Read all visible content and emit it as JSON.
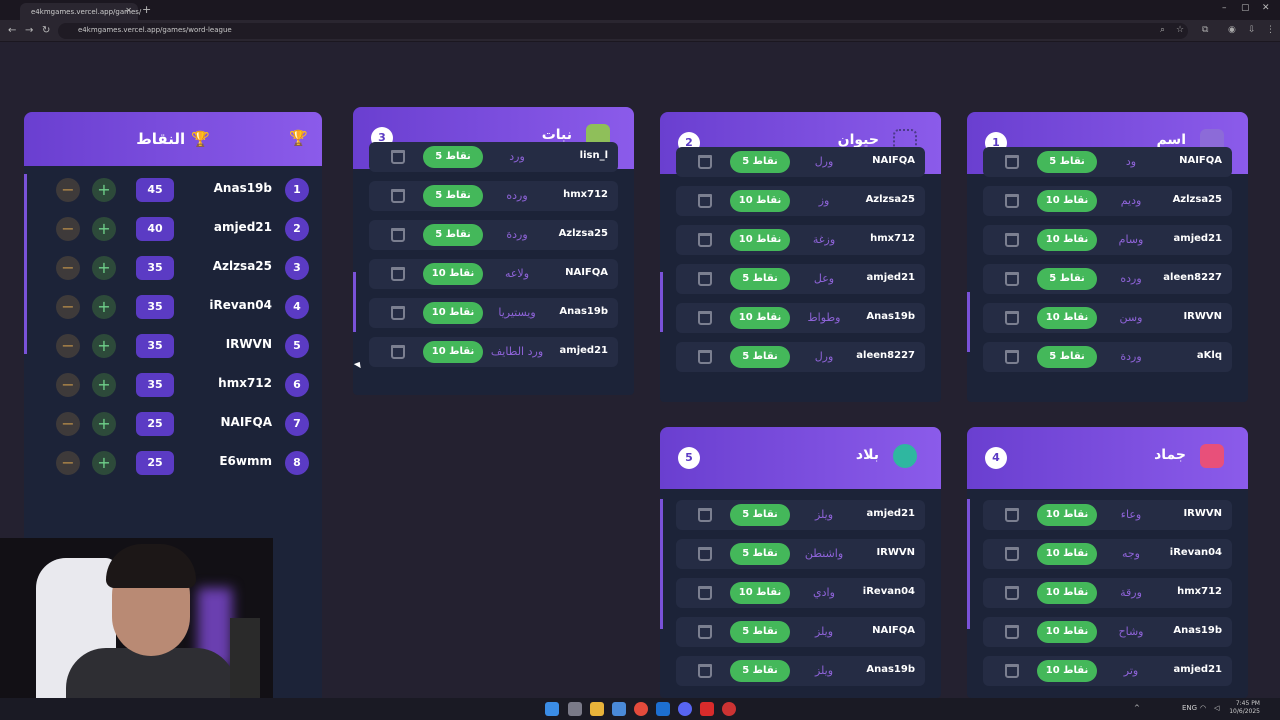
{
  "browser": {
    "tab_title": "e4kmgames.vercel.app/games/",
    "url": "e4kmgames.vercel.app/games/word-league",
    "lang": "ENG",
    "time": "7:45 PM",
    "date": "10/6/2025"
  },
  "scoreboard": {
    "title": "النقاط",
    "minus": "−",
    "plus": "+",
    "rows": [
      {
        "rank": "1",
        "name": "Anas19b",
        "points": "45"
      },
      {
        "rank": "2",
        "name": "amjed21",
        "points": "40"
      },
      {
        "rank": "3",
        "name": "Azlzsa25",
        "points": "35"
      },
      {
        "rank": "4",
        "name": "iRevan04",
        "points": "35"
      },
      {
        "rank": "5",
        "name": "IRWVN",
        "points": "35"
      },
      {
        "rank": "6",
        "name": "hmx712",
        "points": "35"
      },
      {
        "rank": "7",
        "name": "NAIFQA",
        "points": "25"
      },
      {
        "rank": "8",
        "name": "E6wmm",
        "points": "25"
      }
    ]
  },
  "categories": [
    {
      "num": "1",
      "title": "اسم",
      "icon": "user-icon",
      "rows": [
        {
          "name": "NAIFQA",
          "word": "ود",
          "points": "5 نقاط"
        },
        {
          "name": "Azlzsa25",
          "word": "وديم",
          "points": "10 نقاط"
        },
        {
          "name": "amjed21",
          "word": "وسام",
          "points": "10 نقاط"
        },
        {
          "name": "aleen8227",
          "word": "ورده",
          "points": "5 نقاط"
        },
        {
          "name": "IRWVN",
          "word": "وسن",
          "points": "10 نقاط"
        },
        {
          "name": "aKlq",
          "word": "وردة",
          "points": "5 نقاط"
        }
      ]
    },
    {
      "num": "2",
      "title": "حيوان",
      "icon": "paw-icon",
      "rows": [
        {
          "name": "NAIFQA",
          "word": "ورل",
          "points": "5 نقاط"
        },
        {
          "name": "Azlzsa25",
          "word": "وز",
          "points": "10 نقاط"
        },
        {
          "name": "hmx712",
          "word": "وزغة",
          "points": "10 نقاط"
        },
        {
          "name": "amjed21",
          "word": "وعل",
          "points": "5 نقاط"
        },
        {
          "name": "Anas19b",
          "word": "وطواط",
          "points": "10 نقاط"
        },
        {
          "name": "aleen8227",
          "word": "ورل",
          "points": "5 نقاط"
        }
      ]
    },
    {
      "num": "3",
      "title": "نبات",
      "icon": "leaf-icon",
      "rows": [
        {
          "name": "lisn_l",
          "word": "ورد",
          "points": "5 نقاط"
        },
        {
          "name": "hmx712",
          "word": "ورده",
          "points": "5 نقاط"
        },
        {
          "name": "Azlzsa25",
          "word": "وردة",
          "points": "5 نقاط"
        },
        {
          "name": "NAIFQA",
          "word": "ولاعه",
          "points": "10 نقاط"
        },
        {
          "name": "Anas19b",
          "word": "ويستيريا",
          "points": "10 نقاط"
        },
        {
          "name": "amjed21",
          "word": "ورد الطايف",
          "points": "10 نقاط"
        }
      ]
    },
    {
      "num": "4",
      "title": "جماد",
      "icon": "box-icon",
      "rows": [
        {
          "name": "IRWVN",
          "word": "وعاء",
          "points": "10 نقاط"
        },
        {
          "name": "iRevan04",
          "word": "وجه",
          "points": "10 نقاط"
        },
        {
          "name": "hmx712",
          "word": "ورقة",
          "points": "10 نقاط"
        },
        {
          "name": "Anas19b",
          "word": "وشاح",
          "points": "10 نقاط"
        },
        {
          "name": "amjed21",
          "word": "وتر",
          "points": "10 نقاط"
        }
      ]
    },
    {
      "num": "5",
      "title": "بلاد",
      "icon": "globe-icon",
      "rows": [
        {
          "name": "amjed21",
          "word": "ويلز",
          "points": "5 نقاط"
        },
        {
          "name": "IRWVN",
          "word": "واشنطن",
          "points": "5 نقاط"
        },
        {
          "name": "iRevan04",
          "word": "وادي",
          "points": "10 نقاط"
        },
        {
          "name": "NAIFQA",
          "word": "ويلز",
          "points": "5 نقاط"
        },
        {
          "name": "Anas19b",
          "word": "ويلز",
          "points": "5 نقاط"
        }
      ]
    }
  ]
}
